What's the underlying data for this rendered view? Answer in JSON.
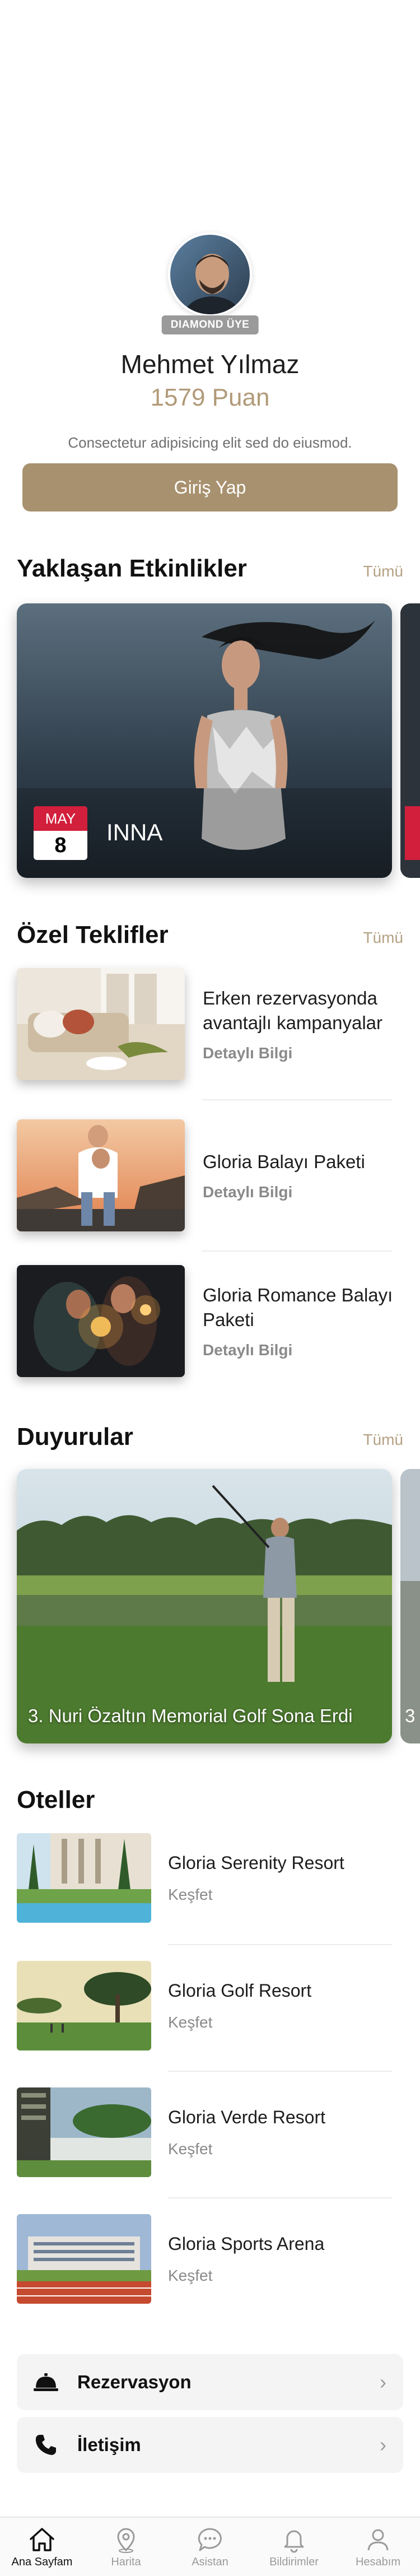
{
  "profile": {
    "badge": "DIAMOND ÜYE",
    "name": "Mehmet Yılmaz",
    "points": "1579 Puan",
    "description": "Consectetur adipisicing elit sed do eiusmod.",
    "login_label": "Giriş Yap"
  },
  "events": {
    "title": "Yaklaşan Etkinlikler",
    "all_label": "Tümü",
    "items": [
      {
        "month": "MAY",
        "day": "8",
        "name": "INNA"
      }
    ]
  },
  "offers": {
    "title": "Özel Teklifler",
    "all_label": "Tümü",
    "items": [
      {
        "title": "Erken rezervasyonda avantajlı kampanyalar",
        "link": "Detaylı Bilgi"
      },
      {
        "title": "Gloria Balayı Paketi",
        "link": "Detaylı Bilgi"
      },
      {
        "title": "Gloria Romance Balayı Paketi",
        "link": "Detaylı Bilgi"
      }
    ]
  },
  "announcements": {
    "title": "Duyurular",
    "all_label": "Tümü",
    "items": [
      {
        "caption": "3. Nuri Özaltın Memorial Golf Sona Erdi"
      }
    ],
    "peek_text": "3"
  },
  "hotels": {
    "title": "Oteller",
    "items": [
      {
        "name": "Gloria Serenity Resort",
        "link": "Keşfet"
      },
      {
        "name": "Gloria Golf Resort",
        "link": "Keşfet"
      },
      {
        "name": "Gloria Verde Resort",
        "link": "Keşfet"
      },
      {
        "name": "Gloria Sports Arena",
        "link": "Keşfet"
      }
    ]
  },
  "links": {
    "reservation": "Rezervasyon",
    "contact": "İletişim"
  },
  "tabbar": {
    "home": "Ana Sayfam",
    "map": "Harita",
    "assistant": "Asistan",
    "notifications": "Bildirimler",
    "account": "Hesabım"
  },
  "colors": {
    "accent": "#a8916f",
    "points": "#b19a79",
    "date_red": "#d21f3c"
  }
}
